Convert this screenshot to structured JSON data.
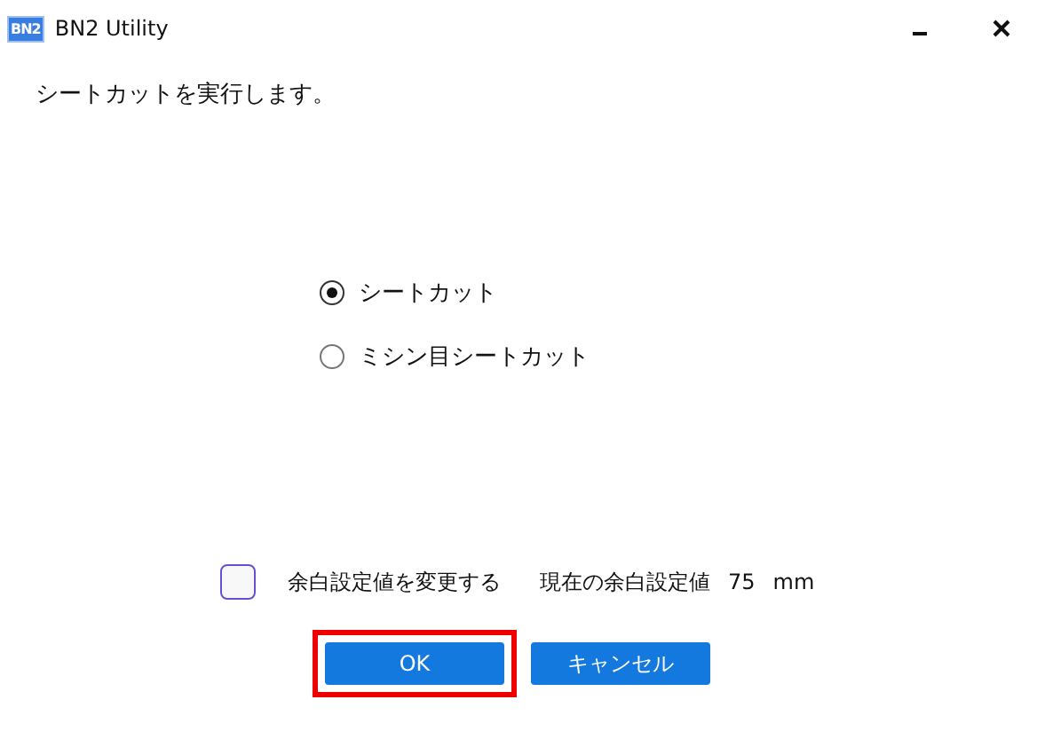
{
  "window": {
    "logo": "BN2",
    "title": "BN2 Utility"
  },
  "message": "シートカットを実行します。",
  "options": [
    {
      "label": "シートカット",
      "selected": true
    },
    {
      "label": "ミシン目シートカット",
      "selected": false
    }
  ],
  "margin": {
    "checkbox_label": "余白設定値を変更する",
    "checked": false,
    "current_label": "現在の余白設定値",
    "value": "75",
    "unit": "mm"
  },
  "buttons": [
    {
      "label": "OK",
      "highlighted": true,
      "kind": "primary"
    },
    {
      "label": "キャンセル",
      "highlighted": false,
      "kind": "primary"
    }
  ]
}
